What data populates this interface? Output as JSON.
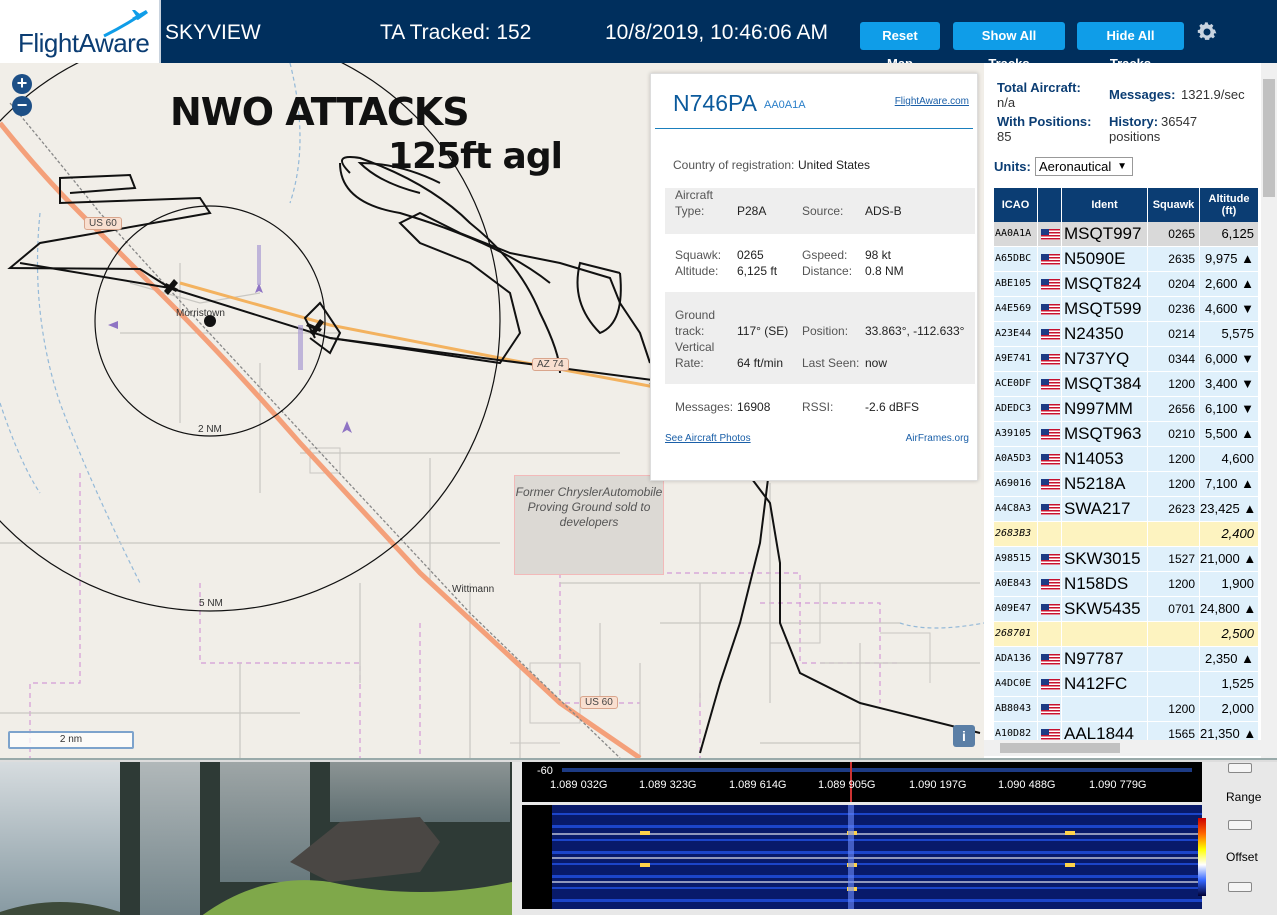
{
  "header": {
    "logo_text": "FlightAware",
    "app_name": "SKYVIEW",
    "ta_tracked": "TA Tracked: 152",
    "datetime": "10/8/2019, 10:46:06 AM",
    "btn_reset": "Reset Map",
    "btn_show": "Show All Tracks",
    "btn_hide": "Hide All Tracks"
  },
  "map": {
    "zoom_in": "+",
    "zoom_out": "−",
    "annotation_1": "NWO ATTACKS",
    "annotation_2": "125ft agl",
    "labels": {
      "us60_top": "US 60",
      "us60_bottom": "US 60",
      "az74": "AZ 74",
      "morristown": "Morristown",
      "wittmann": "Wittmann",
      "ring_2nm": "2 NM",
      "ring_5nm": "5 NM",
      "proving_ground": "Former ChryslerAutomobile Proving Ground sold to developers"
    },
    "scale": "2 nm",
    "info": "i"
  },
  "popup": {
    "registration": "N746PA",
    "hex": "AA0A1A",
    "fa_link": "FlightAware.com",
    "country_label": "Country of registration:",
    "country": "United States",
    "aircraft_type_label1": "Aircraft",
    "aircraft_type_label2": "Type:",
    "aircraft_type": "P28A",
    "source_label": "Source:",
    "source": "ADS-B",
    "squawk_label": "Squawk:",
    "squawk": "0265",
    "gspeed_label": "Gspeed:",
    "gspeed": "98 kt",
    "altitude_label": "Altitude:",
    "altitude": "6,125 ft",
    "distance_label": "Distance:",
    "distance": "0.8 NM",
    "ground_label1": "Ground",
    "ground_label2": "track:",
    "ground_track": "117° (SE)",
    "position_label": "Position:",
    "position": "33.863°, -112.633°",
    "vrate_label1": "Vertical",
    "vrate_label2": "Rate:",
    "vertical_rate": "64 ft/min",
    "lastseen_label": "Last Seen:",
    "last_seen": "now",
    "messages_label": "Messages:",
    "messages": "16908",
    "rssi_label": "RSSI:",
    "rssi": "-2.6 dBFS",
    "photos_link": "See Aircraft Photos",
    "airframes_link": "AirFrames.org"
  },
  "panel": {
    "total_aircraft_label": "Total Aircraft:",
    "total_aircraft": "n/a",
    "messages_label": "Messages:",
    "messages": "1321.9/sec",
    "with_positions_label": "With Positions:",
    "with_positions": "85",
    "history_label": "History:",
    "history": "36547",
    "history_unit": "positions",
    "units_label": "Units:",
    "units_value": "Aeronautical",
    "columns": [
      "ICAO",
      "",
      "Ident",
      "Squawk",
      "Altitude (ft)"
    ],
    "rows": [
      {
        "icao": "AA0A1A",
        "flag": true,
        "ident": "MSQT997",
        "squawk": "0265",
        "alt": "6,125",
        "bg": "#d9d9d9"
      },
      {
        "icao": "A65DBC",
        "flag": true,
        "ident": "N5090E",
        "squawk": "2635",
        "alt": "9,975 ▲",
        "bg": "#dff0fb"
      },
      {
        "icao": "ABE105",
        "flag": true,
        "ident": "MSQT824",
        "squawk": "0204",
        "alt": "2,600 ▲",
        "bg": "#dff0fb"
      },
      {
        "icao": "A4E569",
        "flag": true,
        "ident": "MSQT599",
        "squawk": "0236",
        "alt": "4,600 ▼",
        "bg": "#dff0fb"
      },
      {
        "icao": "A23E44",
        "flag": true,
        "ident": "N24350",
        "squawk": "0214",
        "alt": "5,575",
        "bg": "#dff0fb"
      },
      {
        "icao": "A9E741",
        "flag": true,
        "ident": "N737YQ",
        "squawk": "0344",
        "alt": "6,000 ▼",
        "bg": "#dff0fb"
      },
      {
        "icao": "ACE0DF",
        "flag": true,
        "ident": "MSQT384",
        "squawk": "1200",
        "alt": "3,400 ▼",
        "bg": "#dff0fb"
      },
      {
        "icao": "ADEDC3",
        "flag": true,
        "ident": "N997MM",
        "squawk": "2656",
        "alt": "6,100 ▼",
        "bg": "#dff0fb"
      },
      {
        "icao": "A39105",
        "flag": true,
        "ident": "MSQT963",
        "squawk": "0210",
        "alt": "5,500 ▲",
        "bg": "#dff0fb"
      },
      {
        "icao": "A0A5D3",
        "flag": true,
        "ident": "N14053",
        "squawk": "1200",
        "alt": "4,600",
        "bg": "#dff0fb"
      },
      {
        "icao": "A69016",
        "flag": true,
        "ident": "N5218A",
        "squawk": "1200",
        "alt": "7,100 ▲",
        "bg": "#dff0fb"
      },
      {
        "icao": "A4C8A3",
        "flag": true,
        "ident": "SWA217",
        "squawk": "2623",
        "alt": "23,425 ▲",
        "bg": "#dff0fb"
      },
      {
        "icao": "2683B3",
        "flag": false,
        "ident": "",
        "squawk": "",
        "alt": "2,400",
        "bg": "#fdf3c0",
        "italic": true
      },
      {
        "icao": "A98515",
        "flag": true,
        "ident": "SKW3015",
        "squawk": "1527",
        "alt": "21,000 ▲",
        "bg": "#dff0fb"
      },
      {
        "icao": "A0E843",
        "flag": true,
        "ident": "N158DS",
        "squawk": "1200",
        "alt": "1,900",
        "bg": "#dff0fb"
      },
      {
        "icao": "A09E47",
        "flag": true,
        "ident": "SKW5435",
        "squawk": "0701",
        "alt": "24,800 ▲",
        "bg": "#dff0fb"
      },
      {
        "icao": "268701",
        "flag": false,
        "ident": "",
        "squawk": "",
        "alt": "2,500",
        "bg": "#fdf3c0",
        "italic": true
      },
      {
        "icao": "ADA136",
        "flag": true,
        "ident": "N97787",
        "squawk": "",
        "alt": "2,350 ▲",
        "bg": "#dff0fb"
      },
      {
        "icao": "A4DC0E",
        "flag": true,
        "ident": "N412FC",
        "squawk": "",
        "alt": "1,525",
        "bg": "#dff0fb"
      },
      {
        "icao": "AB8043",
        "flag": true,
        "ident": "",
        "squawk": "1200",
        "alt": "2,000",
        "bg": "#dff0fb"
      },
      {
        "icao": "A10D82",
        "flag": true,
        "ident": "AAL1844",
        "squawk": "1565",
        "alt": "21,350 ▲",
        "bg": "#dff0fb"
      }
    ]
  },
  "sdr": {
    "db_label": "-60",
    "frequencies": [
      "1.089 032G",
      "1.089 323G",
      "1.089 614G",
      "1.089 905G",
      "1.090 197G",
      "1.090 488G",
      "1.090 779G"
    ],
    "range_label": "Range",
    "offset_label": "Offset"
  },
  "colors": {
    "header_bg": "#002f5d",
    "button_bg": "#0f9de8",
    "table_header_bg": "#0b3d73",
    "row_bg": "#dff0fb",
    "selected_row_bg": "#d9d9d9",
    "mlat_row_bg": "#fdf3c0"
  }
}
